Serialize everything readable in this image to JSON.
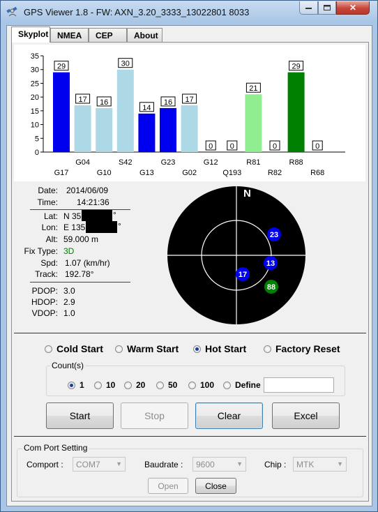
{
  "window": {
    "title": "GPS Viewer 1.8 - FW: AXN_3.20_3333_13022801 8033",
    "close_glyph": "✕"
  },
  "tabs": [
    {
      "label": "Skyplot",
      "active": true
    },
    {
      "label": "NMEA",
      "active": false
    },
    {
      "label": "CEP",
      "active": false
    },
    {
      "label": "About",
      "active": false
    }
  ],
  "chart_data": {
    "type": "bar",
    "ylim": [
      0,
      35
    ],
    "yticks": [
      "0",
      "5",
      "10",
      "15",
      "20",
      "25",
      "30",
      "35"
    ],
    "categories": [
      "G17",
      "G04",
      "G10",
      "S42",
      "G13",
      "G23",
      "G02",
      "G12",
      "Q193",
      "R81",
      "R82",
      "R88",
      "R68"
    ],
    "values": [
      29,
      17,
      16,
      30,
      14,
      16,
      17,
      0,
      0,
      21,
      0,
      29,
      0
    ],
    "colors": [
      "#0000ee",
      "#add8e6",
      "#add8e6",
      "#add8e6",
      "#0000ee",
      "#0000ee",
      "#add8e6",
      "#add8e6",
      "#add8e6",
      "#90ee90",
      "#90ee90",
      "#008000",
      "#90ee90"
    ]
  },
  "info": {
    "date_label": "Date:",
    "date": "2014/06/09",
    "time_label": "Time:",
    "time": "14:21:36",
    "lat_label": "Lat:",
    "lat_prefix": "N 35",
    "lat_suffix": "°",
    "lon_label": "Lon:",
    "lon_prefix": "E 135",
    "lon_suffix": "°",
    "alt_label": "Alt:",
    "alt": "59.000 m",
    "fix_label": "Fix Type:",
    "fix": "3D",
    "fix_color": "#008000",
    "spd_label": "Spd:",
    "spd": "1.07 (km/hr)",
    "track_label": "Track:",
    "track": "192.78°",
    "pdop_label": "PDOP:",
    "pdop": "3.0",
    "hdop_label": "HDOP:",
    "hdop": "2.9",
    "vdop_label": "VDOP:",
    "vdop": "1.0"
  },
  "skyplot": {
    "north": "N",
    "satellites": [
      {
        "id": "23",
        "color": "#0000ee"
      },
      {
        "id": "13",
        "color": "#0000ee"
      },
      {
        "id": "17",
        "color": "#0000ee"
      },
      {
        "id": "88",
        "color": "#008000"
      }
    ]
  },
  "start_modes": [
    {
      "label": "Cold Start",
      "selected": false
    },
    {
      "label": "Warm Start",
      "selected": false
    },
    {
      "label": "Hot Start",
      "selected": true
    },
    {
      "label": "Factory Reset",
      "selected": false
    }
  ],
  "count": {
    "title": "Count(s)",
    "options": [
      {
        "label": "1",
        "selected": true
      },
      {
        "label": "10",
        "selected": false
      },
      {
        "label": "20",
        "selected": false
      },
      {
        "label": "50",
        "selected": false
      },
      {
        "label": "100",
        "selected": false
      },
      {
        "label": "Define",
        "selected": false
      }
    ],
    "define_value": ""
  },
  "actions": {
    "start": "Start",
    "stop": "Stop",
    "clear": "Clear",
    "excel": "Excel"
  },
  "com": {
    "title": "Com Port Setting",
    "comport_label": "Comport :",
    "comport_value": "COM7",
    "baud_label": "Baudrate :",
    "baud_value": "9600",
    "chip_label": "Chip :",
    "chip_value": "MTK",
    "open": "Open",
    "close": "Close"
  }
}
